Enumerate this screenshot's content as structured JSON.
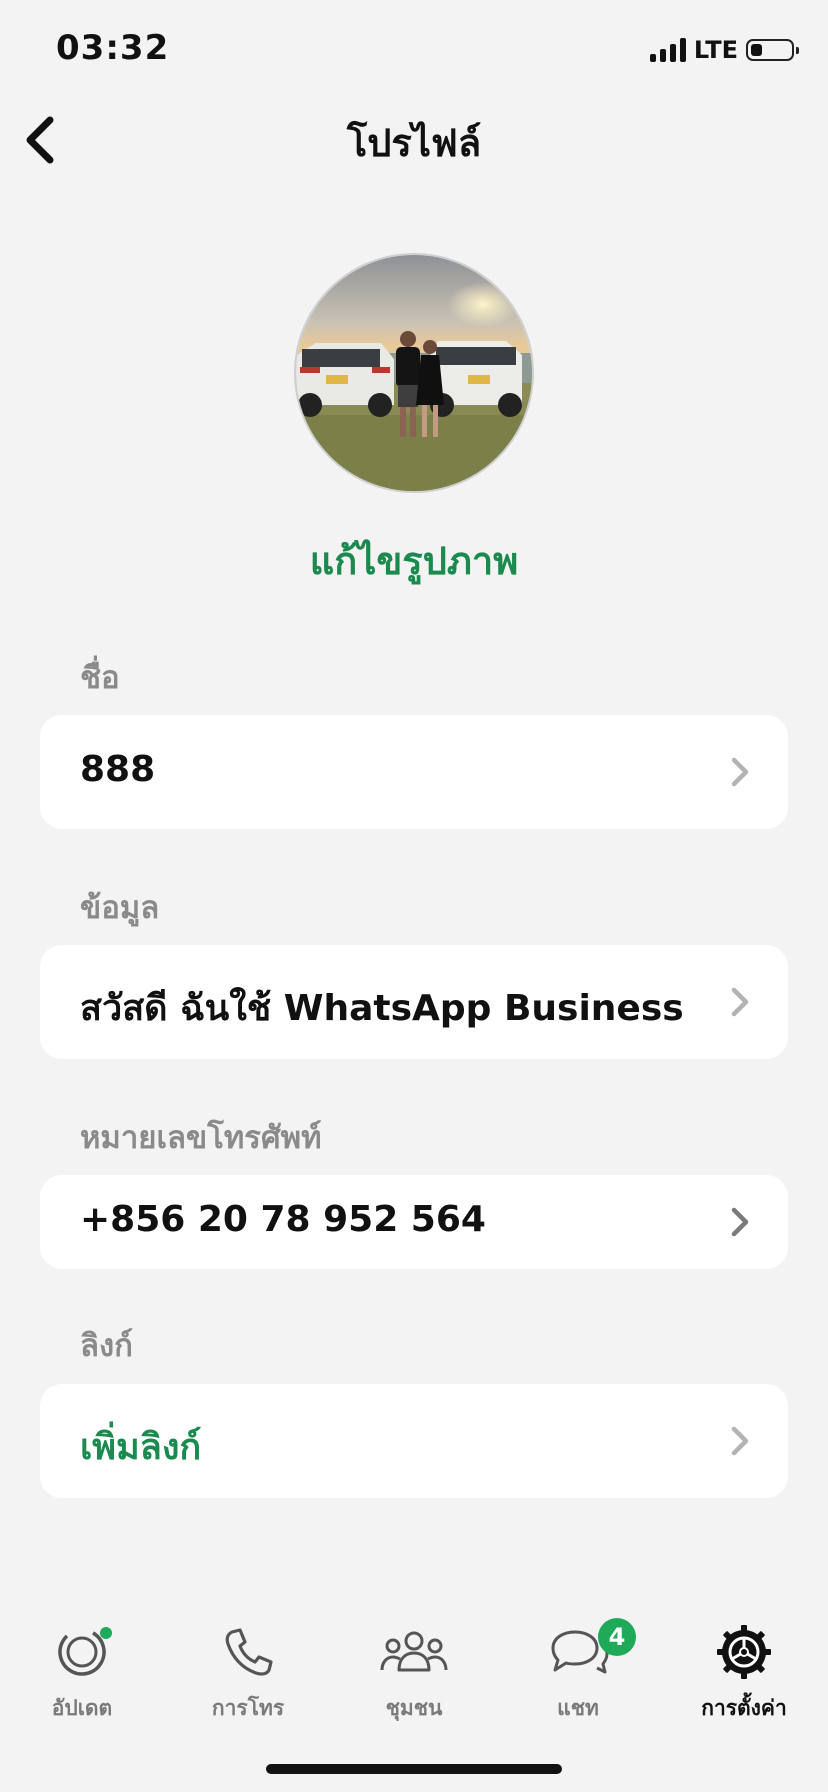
{
  "status": {
    "time": "03:32",
    "network": "LTE"
  },
  "nav": {
    "title": "โปรไฟล์"
  },
  "profile": {
    "edit_photo_label": "แก้ไขรูปภาพ"
  },
  "fields": {
    "name": {
      "label": "ชื่อ",
      "value": "888"
    },
    "about": {
      "label": "ข้อมูล",
      "value": "สวัสดี ฉันใช้ WhatsApp Business"
    },
    "phone": {
      "label": "หมายเลขโทรศัพท์",
      "value": "+856 20 78 952 564"
    },
    "link": {
      "label": "ลิงก์",
      "value": "เพิ่มลิงก์"
    }
  },
  "tabs": [
    {
      "label": "อัปเดต",
      "icon": "updates-icon"
    },
    {
      "label": "การโทร",
      "icon": "phone-icon"
    },
    {
      "label": "ชุมชน",
      "icon": "community-icon"
    },
    {
      "label": "แชท",
      "icon": "chat-icon",
      "badge": "4"
    },
    {
      "label": "การตั้งค่า",
      "icon": "gear-icon",
      "active": true
    }
  ],
  "colors": {
    "accent": "#1b8a4e",
    "badge": "#1faa59",
    "background": "#f3f3f3"
  }
}
